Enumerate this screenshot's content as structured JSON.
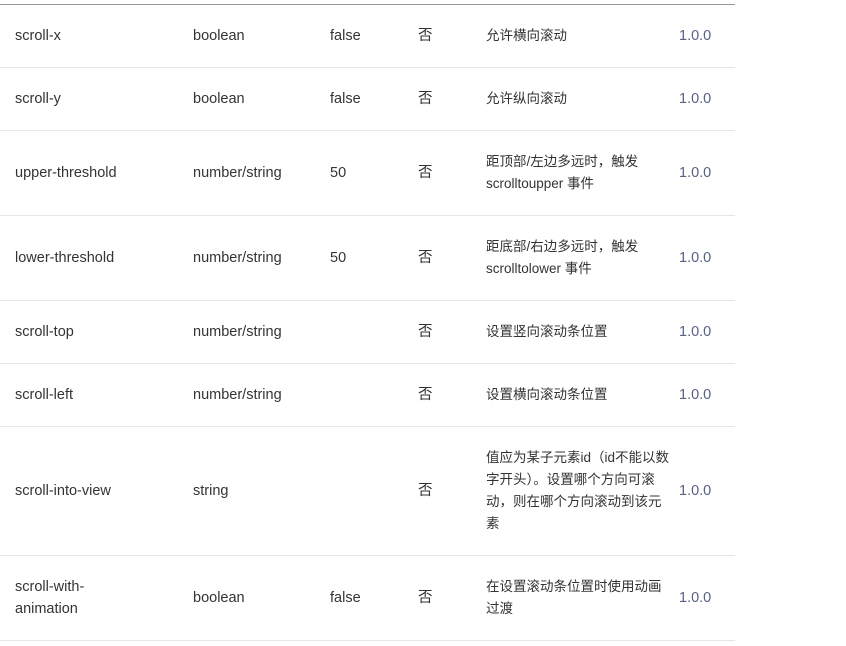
{
  "rows": [
    {
      "name": "scroll-x",
      "type": "boolean",
      "default": "false",
      "required": "否",
      "desc": "允许横向滚动",
      "version": "1.0.0"
    },
    {
      "name": "scroll-y",
      "type": "boolean",
      "default": "false",
      "required": "否",
      "desc": "允许纵向滚动",
      "version": "1.0.0"
    },
    {
      "name": "upper-threshold",
      "type": "number/string",
      "default": "50",
      "required": "否",
      "desc": "距顶部/左边多远时，触发 scrolltoupper 事件",
      "version": "1.0.0"
    },
    {
      "name": "lower-threshold",
      "type": "number/string",
      "default": "50",
      "required": "否",
      "desc": "距底部/右边多远时，触发 scrolltolower 事件",
      "version": "1.0.0"
    },
    {
      "name": "scroll-top",
      "type": "number/string",
      "default": "",
      "required": "否",
      "desc": "设置竖向滚动条位置",
      "version": "1.0.0"
    },
    {
      "name": "scroll-left",
      "type": "number/string",
      "default": "",
      "required": "否",
      "desc": "设置横向滚动条位置",
      "version": "1.0.0"
    },
    {
      "name": "scroll-into-view",
      "type": "string",
      "default": "",
      "required": "否",
      "desc": "值应为某子元素id（id不能以数字开头）。设置哪个方向可滚动，则在哪个方向滚动到该元素",
      "version": "1.0.0"
    },
    {
      "name": "scroll-with-animation",
      "type": "boolean",
      "default": "false",
      "required": "否",
      "desc": "在设置滚动条位置时使用动画过渡",
      "version": "1.0.0"
    }
  ]
}
